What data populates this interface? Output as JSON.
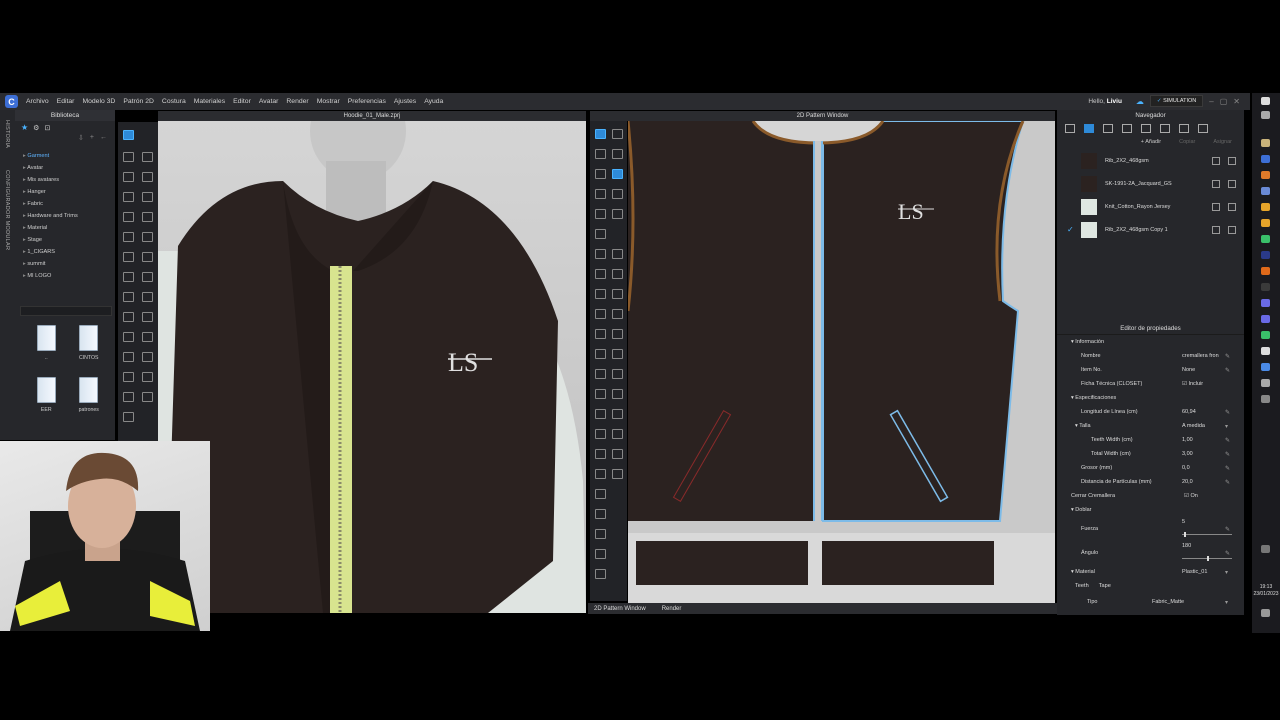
{
  "menubar": {
    "items": [
      "Archivo",
      "Editar",
      "Modelo 3D",
      "Patrón 2D",
      "Costura",
      "Materiales",
      "Editor",
      "Avatar",
      "Render",
      "Mostrar",
      "Preferencias",
      "Ajustes",
      "Ayuda"
    ],
    "hello_prefix": "Hello,",
    "user": "Liviu",
    "simulation": "SIMULATION"
  },
  "left": {
    "history_tab": "HISTORIA",
    "config_tab": "CONFIGURADOR MODULAR",
    "library_title": "Biblioteca",
    "tree": [
      "Garment",
      "Avatar",
      "Mis avatares",
      "Hanger",
      "Fabric",
      "Hardware and Trims",
      "Material",
      "Stage",
      "1_CIGARS",
      "summit",
      "MI LOGO"
    ],
    "folders": [
      "..",
      "CINTOS",
      "EER",
      "patrones"
    ]
  },
  "view3d": {
    "title": "Hoodie_01_Male.zprj",
    "logo_text": "LS"
  },
  "view2d": {
    "title": "2D Pattern Window",
    "logo_text": "LS",
    "bottom_tabs": [
      "2D Pattern Window",
      "Render"
    ]
  },
  "navigator": {
    "title": "Navegador",
    "add_label": "+ Añadir",
    "copy_label": "Copiar",
    "assign_label": "Asignar",
    "materials": [
      {
        "name": "Rib_2X2_468gsm",
        "color": "#2b2220",
        "checked": false
      },
      {
        "name": "SK-1991-2A_Jacquard_GS",
        "color": "#2b2220",
        "checked": false
      },
      {
        "name": "Knit_Cotton_Rayon Jersey",
        "color": "#dfe7e2",
        "checked": false
      },
      {
        "name": "Rib_2X2_468gsm Copy 1",
        "color": "#dfe7e2",
        "checked": true
      }
    ]
  },
  "properties": {
    "title": "Editor de propiedades",
    "info_section": "Información",
    "name_label": "Nombre",
    "name_value": "cremallera fron",
    "item_label": "Item No.",
    "item_value": "None",
    "closet_label": "Ficha Técnica (CLOSET)",
    "closet_value": "Incluir",
    "spec_section": "Especificaciones",
    "length_label": "Longitud de Línea (cm)",
    "length_value": "60,94",
    "size_label": "Talla",
    "size_value": "A medida",
    "teeth_label": "Teeth Width (cm)",
    "teeth_value": "1,00",
    "total_label": "Total Width (cm)",
    "total_value": "3,00",
    "thick_label": "Grosor (mm)",
    "thick_value": "0,0",
    "particle_label": "Distancia de Partículas (mm)",
    "particle_value": "20,0",
    "close_label": "Cerrar Cremallera",
    "close_value": "On",
    "fold_section": "Doblar",
    "force_label": "Fuerza",
    "force_value": "5",
    "angle_label": "Ángulo",
    "angle_value": "180",
    "material_section": "Material",
    "material_value": "Plastic_01",
    "tab_teeth": "Teeth",
    "tab_tape": "Tape",
    "type_label": "Tipo",
    "type_value": "Fabric_Matte"
  },
  "clock": {
    "time": "19:13",
    "date": "23/01/2023"
  }
}
